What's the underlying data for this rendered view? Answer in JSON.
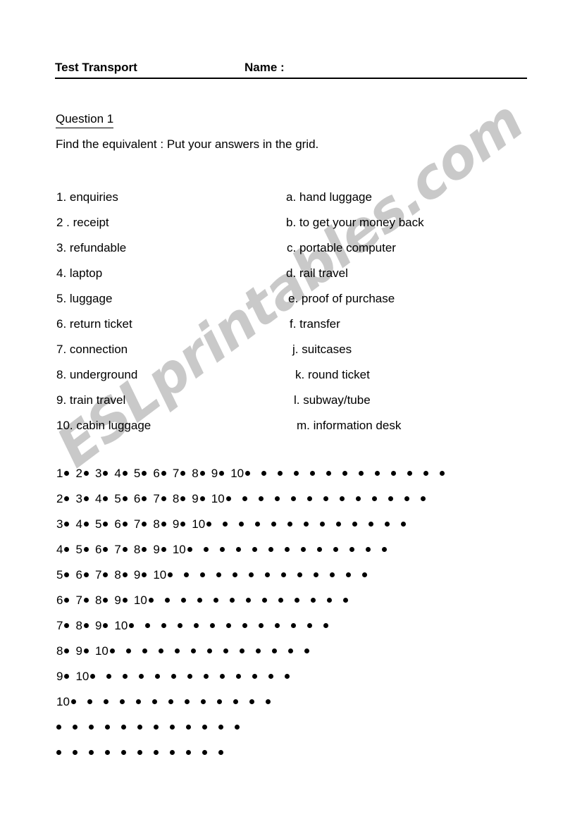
{
  "document": {
    "title": "Test Transport",
    "name_label": "Name :",
    "question_label": "Question 1",
    "instruction": "Find the equivalent : Put your answers in the grid.",
    "watermark": "ESLprintables.com",
    "watermark_color": "#c9c9c9"
  },
  "terms": [
    {
      "number": "1.",
      "text": "enquiries",
      "full": "1. enquiries"
    },
    {
      "number": "2 .",
      "text": "receipt",
      "full": "2 . receipt"
    },
    {
      "number": "3.",
      "text": "refundable",
      "full": "3. refundable"
    },
    {
      "number": "4.",
      "text": "laptop",
      "full": "4. laptop"
    },
    {
      "number": "5.",
      "text": "luggage",
      "full": "5. luggage"
    },
    {
      "number": "6.",
      "text": "return ticket",
      "full": "6. return ticket"
    },
    {
      "number": "7.",
      "text": "connection",
      "full": "7. connection"
    },
    {
      "number": "8.",
      "text": "underground",
      "full": "8. underground"
    },
    {
      "number": "9.",
      "text": "train travel",
      "full": "9. train travel"
    },
    {
      "number": "10.",
      "text": "cabin luggage",
      "full": "10. cabin luggage"
    }
  ],
  "definitions": [
    {
      "letter": "a.",
      "text": "hand luggage",
      "full": "a.  hand luggage",
      "indent": 0
    },
    {
      "letter": "b.",
      "text": "to get your money back",
      "full": "b.  to get your money back",
      "indent": 0
    },
    {
      "letter": "c.",
      "text": "portable computer",
      "full": "c.  portable computer",
      "indent": 1
    },
    {
      "letter": "d.",
      "text": "rail travel",
      "full": "d.  rail travel",
      "indent": 0
    },
    {
      "letter": "e.",
      "text": "proof of purchase",
      "full": "e.  proof of purchase",
      "indent": 3
    },
    {
      "letter": "f.",
      "text": "transfer",
      "full": "f. transfer",
      "indent": 5
    },
    {
      "letter": "j.",
      "text": "suitcases",
      "full": "j. suitcases",
      "indent": 9
    },
    {
      "letter": "k.",
      "text": "round ticket",
      "full": "k. round ticket",
      "indent": 13
    },
    {
      "letter": "l.",
      "text": "subway/tube",
      "full": "l. subway/tube",
      "indent": 11
    },
    {
      "letter": "m.",
      "text": "information desk",
      "full": "m.  information desk",
      "indent": 15
    }
  ],
  "answer_grid": {
    "rows": [
      {
        "numbers": [
          "1",
          "2",
          "3",
          "4",
          "5",
          "6",
          "7",
          "8",
          "9",
          "10"
        ],
        "extra_dots": 12
      },
      {
        "numbers": [
          "2",
          "3",
          "4",
          "5",
          "6",
          "7",
          "8",
          "9",
          "10"
        ],
        "extra_dots": 12
      },
      {
        "numbers": [
          "3",
          "4",
          "5",
          "6",
          "7",
          "8",
          "9",
          "10"
        ],
        "extra_dots": 12
      },
      {
        "numbers": [
          "4",
          "5",
          "6",
          "7",
          "8",
          "9",
          "10"
        ],
        "extra_dots": 12
      },
      {
        "numbers": [
          "5",
          "6",
          "7",
          "8",
          "9",
          "10"
        ],
        "extra_dots": 12
      },
      {
        "numbers": [
          "6",
          "7",
          "8",
          "9",
          "10"
        ],
        "extra_dots": 12
      },
      {
        "numbers": [
          "7",
          "8",
          "9",
          "10"
        ],
        "extra_dots": 12
      },
      {
        "numbers": [
          "8",
          "9",
          "10"
        ],
        "extra_dots": 12
      },
      {
        "numbers": [
          "9",
          "10"
        ],
        "extra_dots": 12
      },
      {
        "numbers": [
          "10"
        ],
        "extra_dots": 12
      },
      {
        "numbers": [],
        "extra_dots": 12
      },
      {
        "numbers": [],
        "extra_dots": 11
      }
    ]
  }
}
